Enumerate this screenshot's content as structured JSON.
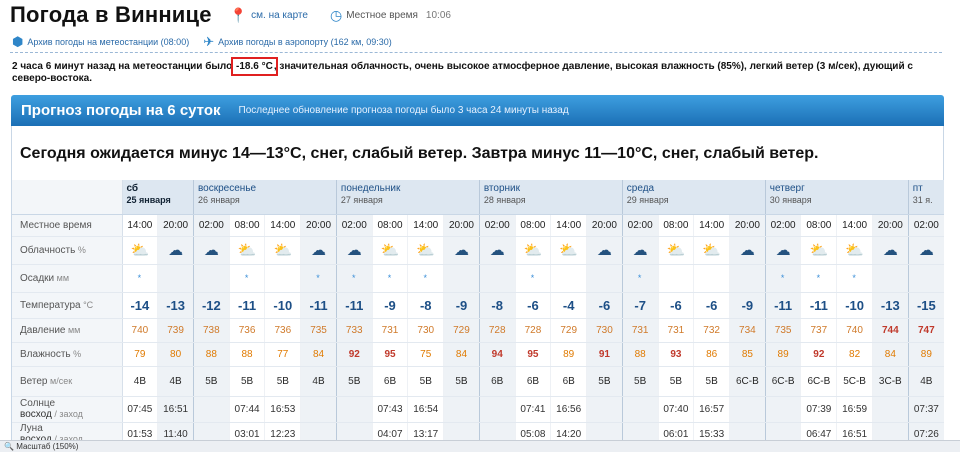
{
  "header": {
    "title": "Погода в Виннице",
    "map_link": "см. на карте",
    "local_time_label": "Местное время",
    "local_time": "10:06"
  },
  "subnav": {
    "archive_station": "Архив погоды на метеостанции (08:00)",
    "archive_airport": "Архив погоды в аэропорту (162 км, 09:30)"
  },
  "observation": {
    "before": "2 часа 6 минут назад на метеостанции было",
    "temp": "-18.6 °C",
    "after": ", значительная облачность, очень высокое атмосферное давление, высокая влажность (85%), легкий ветер (3 м/сек), дующий с северо-востока."
  },
  "panel": {
    "title": "Прогноз погоды на 6 суток",
    "updated": "Последнее обновление прогноза погоды было 3 часа 24 минуты назад",
    "summary": "Сегодня ожидается минус 14—13°C, снег, слабый ветер. Завтра минус 11—10°C, снег, слабый ветер."
  },
  "labels": {
    "time": "Местное время",
    "cloud": "Облачность",
    "cloud_unit": "%",
    "precip": "Осадки",
    "precip_unit": "мм",
    "temp": "Температура",
    "temp_unit": "°C",
    "pressure": "Давление",
    "pressure_unit": "мм",
    "humidity": "Влажность",
    "humidity_unit": "%",
    "wind": "Ветер",
    "wind_unit": "м/сек",
    "sun": "Солнце",
    "sun_sub": "восход",
    "sun_sub2": "/ заход",
    "moon": "Луна",
    "moon_sub": "восход",
    "moon_sub2": "/ заход"
  },
  "days": [
    {
      "name": "сб",
      "date": "25 января",
      "cols": 2
    },
    {
      "name": "воскресенье",
      "date": "26 января",
      "cols": 4
    },
    {
      "name": "понедельник",
      "date": "27 января",
      "cols": 4
    },
    {
      "name": "вторник",
      "date": "28 января",
      "cols": 4
    },
    {
      "name": "среда",
      "date": "29 января",
      "cols": 4
    },
    {
      "name": "четверг",
      "date": "30 января",
      "cols": 4
    },
    {
      "name": "пт",
      "date": "31 я.",
      "cols": 1
    }
  ],
  "times": [
    "14:00",
    "20:00",
    "02:00",
    "08:00",
    "14:00",
    "20:00",
    "02:00",
    "08:00",
    "14:00",
    "20:00",
    "02:00",
    "08:00",
    "14:00",
    "20:00",
    "02:00",
    "08:00",
    "14:00",
    "20:00",
    "02:00",
    "08:00",
    "14:00",
    "20:00",
    "02:00"
  ],
  "clouds": [
    "cloud-sun-icon",
    "cloud-night-icon",
    "cloud-night-icon",
    "cloud-sun-icon",
    "cloud-sun-icon",
    "cloud-night-icon",
    "cloud-night-icon",
    "cloud-sun-icon",
    "cloud-sun-icon",
    "cloud-night-icon",
    "cloud-night-icon",
    "cloud-sun-icon",
    "cloud-sun-icon",
    "cloud-night-icon",
    "cloud-night-icon",
    "cloud-sun-icon",
    "cloud-sun-icon",
    "cloud-night-icon",
    "cloud-night-icon",
    "cloud-sun-icon",
    "cloud-sun-icon",
    "cloud-night-icon",
    "cloud-night-icon"
  ],
  "precip": [
    "*",
    "",
    "",
    "*",
    "",
    "*",
    "*",
    "*",
    "*",
    "",
    "",
    "*",
    "",
    "",
    "*",
    "",
    "",
    "",
    "*",
    "*",
    "*",
    "",
    ""
  ],
  "temps": [
    "-14",
    "-13",
    "-12",
    "-11",
    "-10",
    "-11",
    "-11",
    "-9",
    "-8",
    "-9",
    "-8",
    "-6",
    "-4",
    "-6",
    "-7",
    "-6",
    "-6",
    "-9",
    "-11",
    "-11",
    "-10",
    "-13",
    "-15"
  ],
  "pressure": [
    "740",
    "739",
    "738",
    "736",
    "736",
    "735",
    "733",
    "731",
    "730",
    "729",
    "728",
    "728",
    "729",
    "730",
    "731",
    "731",
    "732",
    "734",
    "735",
    "737",
    "740",
    "744",
    "747"
  ],
  "pressure_hi": [
    21,
    22
  ],
  "humidity": [
    "79",
    "80",
    "88",
    "88",
    "77",
    "84",
    "92",
    "95",
    "75",
    "84",
    "94",
    "95",
    "89",
    "91",
    "88",
    "93",
    "86",
    "85",
    "89",
    "92",
    "82",
    "84",
    "89"
  ],
  "humidity_hi": [
    6,
    7,
    10,
    11,
    13,
    15,
    19
  ],
  "wind_speed": [
    "4",
    "4",
    "5",
    "5",
    "5",
    "4",
    "5",
    "6",
    "5",
    "5",
    "6",
    "6",
    "6",
    "5",
    "5",
    "5",
    "5",
    "6",
    "6",
    "6",
    "5",
    "3",
    "4"
  ],
  "wind_dir": [
    "В",
    "В",
    "В",
    "В",
    "В",
    "В",
    "В",
    "В",
    "В",
    "В",
    "В",
    "В",
    "В",
    "В",
    "В",
    "В",
    "В",
    "С-В",
    "С-В",
    "С-В",
    "С-В",
    "С-В",
    "В"
  ],
  "sun": [
    "07:45",
    "16:51",
    "",
    "07:44",
    "16:53",
    "",
    "",
    "07:43",
    "16:54",
    "",
    "",
    "07:41",
    "16:56",
    "",
    "",
    "07:40",
    "16:57",
    "",
    "",
    "07:39",
    "16:59",
    "",
    "07:37"
  ],
  "moon": [
    "01:53",
    "11:40",
    "",
    "03:01",
    "12:23",
    "",
    "",
    "04:07",
    "13:17",
    "",
    "",
    "05:08",
    "14:20",
    "",
    "",
    "06:01",
    "15:33",
    "",
    "",
    "06:47",
    "16:51",
    "",
    "07:26"
  ],
  "status": "Масштаб (150%)"
}
